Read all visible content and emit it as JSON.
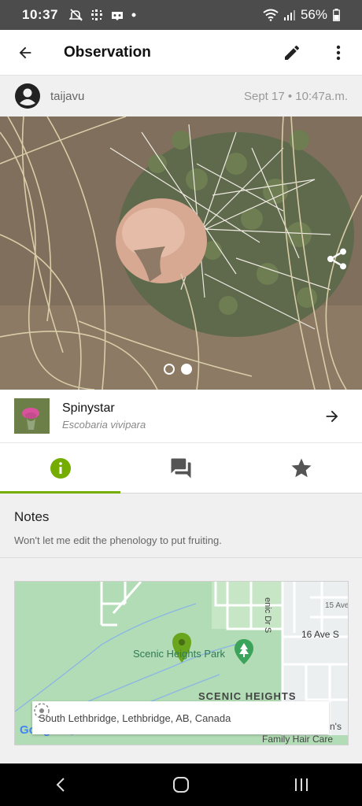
{
  "status_bar": {
    "time": "10:37",
    "battery": "56%"
  },
  "app_bar": {
    "title": "Observation",
    "icons": [
      "back-arrow-icon",
      "pencil-icon",
      "more-vert-icon"
    ]
  },
  "observation": {
    "username": "taijavu",
    "date": "Sept 17 • 10:47a.m.",
    "photo_count": 2,
    "photo_index": 2
  },
  "species": {
    "common_name": "Spinystar",
    "scientific_name": "Escobaria vivipara"
  },
  "tabs": [
    {
      "name": "info",
      "icon": "info-icon",
      "active": true
    },
    {
      "name": "comments",
      "icon": "chat-icon",
      "active": false
    },
    {
      "name": "favorite",
      "icon": "star-icon",
      "active": false
    }
  ],
  "notes": {
    "label": "Notes",
    "text": "Won't let me edit the phenology to put fruiting."
  },
  "map": {
    "labels": {
      "park": "Scenic Heights Park",
      "neighborhood": "SCENIC HEIGHTS",
      "street_16": "16 Ave S",
      "street_15": "15 Ave",
      "scenic_dr": "enic Dr S",
      "business": "Family Hair Care",
      "business_partial": "n's",
      "google": "Google"
    },
    "address": "South Lethbridge, Lethbridge, AB, Canada"
  },
  "colors": {
    "accent": "#74ac00",
    "status_bar": "#4c4c4c",
    "map_green": "#b2dcb5"
  }
}
